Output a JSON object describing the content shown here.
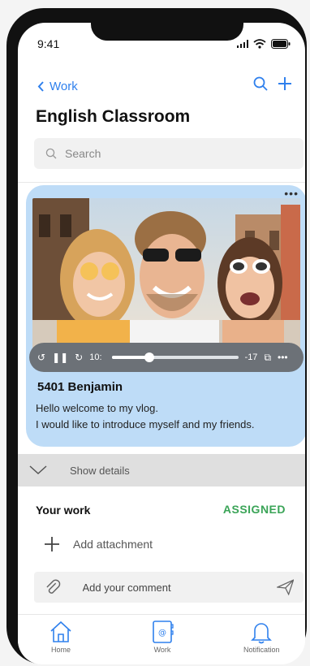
{
  "status": {
    "time": "9:41"
  },
  "nav": {
    "back_label": "Work"
  },
  "page": {
    "title": "English Classroom"
  },
  "search": {
    "placeholder": "Search"
  },
  "post": {
    "author": "5401 Benjamin",
    "caption_line1": "Hello welcome to my vlog.",
    "caption_line2": "I would like to introduce myself and my friends.",
    "player": {
      "elapsed": "10:",
      "remaining": "-17",
      "progress": 0.3
    }
  },
  "details": {
    "label": "Show details"
  },
  "work": {
    "label": "Your work",
    "status": "ASSIGNED",
    "add_attachment": "Add attachment",
    "comment_placeholder": "Add your comment"
  },
  "tabs": [
    {
      "label": "Home",
      "icon": "home-icon"
    },
    {
      "label": "Work",
      "icon": "work-book-icon"
    },
    {
      "label": "Notification",
      "icon": "bell-icon"
    }
  ],
  "colors": {
    "accent": "#2f80ed",
    "card": "#bedcf7",
    "assigned": "#3aa457"
  }
}
